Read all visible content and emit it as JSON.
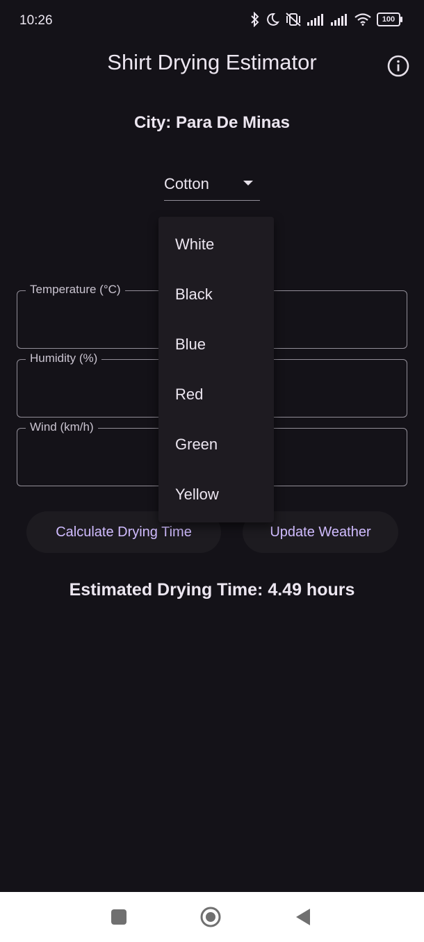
{
  "status_bar": {
    "time": "10:26",
    "battery": "100",
    "icons": [
      "bluetooth-icon",
      "do-not-disturb-moon-icon",
      "mute-vibrate-icon",
      "signal-icon",
      "signal-icon",
      "wifi-icon",
      "battery-icon"
    ]
  },
  "app_bar": {
    "title": "Shirt Drying Estimator",
    "info_icon": "info-icon"
  },
  "city": "City: Para De Minas",
  "fabric_dropdown": {
    "selected": "Cotton"
  },
  "fields": {
    "temperature_label": "Temperature (°C)",
    "humidity_label": "Humidity (%)",
    "wind_label": "Wind (km/h)"
  },
  "color_menu": {
    "options": [
      "White",
      "Black",
      "Blue",
      "Red",
      "Green",
      "Yellow"
    ]
  },
  "buttons": {
    "calculate": "Calculate Drying Time",
    "update_weather": "Update Weather"
  },
  "result": "Estimated Drying Time: 4.49 hours",
  "nav_bar": {
    "icons": [
      "square-recents-icon",
      "circle-home-icon",
      "triangle-back-icon"
    ]
  },
  "colors": {
    "background": "#141218",
    "accent": "#D0BCFF",
    "menu_surface": "#1E1B21",
    "outline": "#938F99"
  }
}
